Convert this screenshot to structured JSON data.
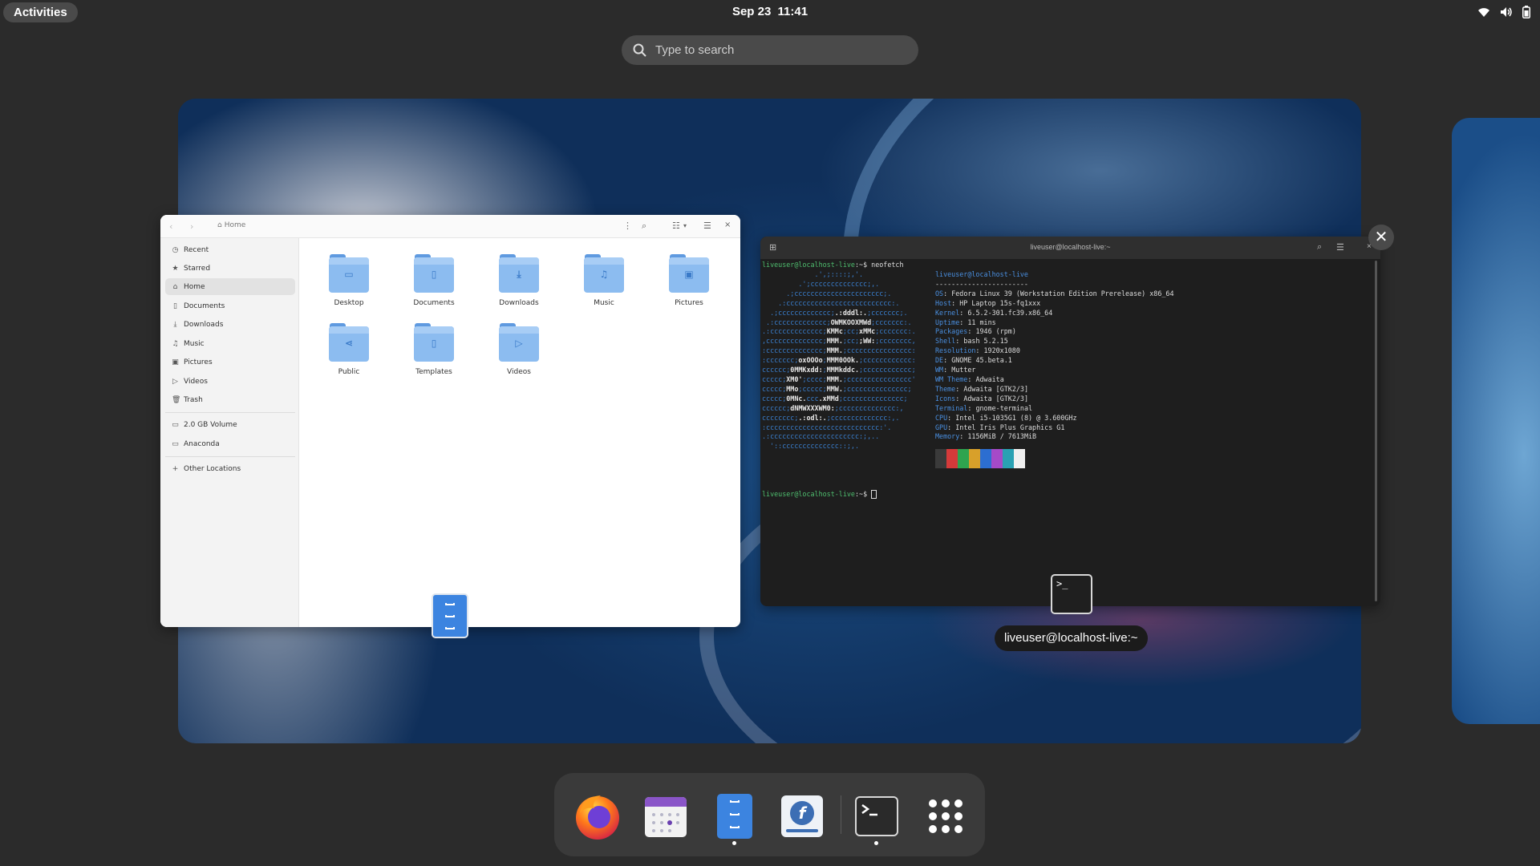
{
  "topbar": {
    "activities_label": "Activities",
    "date": "Sep 23",
    "time": "11:41"
  },
  "search": {
    "placeholder": "Type to search"
  },
  "files_window": {
    "path_label": "Home",
    "sidebar": {
      "places": [
        "Recent",
        "Starred",
        "Home",
        "Documents",
        "Downloads",
        "Music",
        "Pictures",
        "Videos",
        "Trash"
      ],
      "devices": [
        "2.0 GB Volume",
        "Anaconda"
      ],
      "other": "Other Locations",
      "active": "Home"
    },
    "folders": [
      {
        "name": "Desktop",
        "icon": "desktop-icon"
      },
      {
        "name": "Documents",
        "icon": "document-icon"
      },
      {
        "name": "Downloads",
        "icon": "download-icon"
      },
      {
        "name": "Music",
        "icon": "music-icon"
      },
      {
        "name": "Pictures",
        "icon": "picture-icon"
      },
      {
        "name": "Public",
        "icon": "share-icon"
      },
      {
        "name": "Templates",
        "icon": "template-icon"
      },
      {
        "name": "Videos",
        "icon": "video-icon"
      }
    ]
  },
  "terminal_window": {
    "title": "liveuser@localhost-live:~",
    "prompt": "liveuser@localhost-live",
    "prompt_suffix": ":~$ ",
    "command": "neofetch",
    "user_host": "liveuser@localhost-live",
    "separator": "-----------------------",
    "info": [
      {
        "key": "OS",
        "value": "Fedora Linux 39 (Workstation Edition Prerelease) x86_64"
      },
      {
        "key": "Host",
        "value": "HP Laptop 15s-fq1xxx"
      },
      {
        "key": "Kernel",
        "value": "6.5.2-301.fc39.x86_64"
      },
      {
        "key": "Uptime",
        "value": "11 mins"
      },
      {
        "key": "Packages",
        "value": "1946 (rpm)"
      },
      {
        "key": "Shell",
        "value": "bash 5.2.15"
      },
      {
        "key": "Resolution",
        "value": "1920x1080"
      },
      {
        "key": "DE",
        "value": "GNOME 45.beta.1"
      },
      {
        "key": "WM",
        "value": "Mutter"
      },
      {
        "key": "WM Theme",
        "value": "Adwaita"
      },
      {
        "key": "Theme",
        "value": "Adwaita [GTK2/3]"
      },
      {
        "key": "Icons",
        "value": "Adwaita [GTK2/3]"
      },
      {
        "key": "Terminal",
        "value": "gnome-terminal"
      },
      {
        "key": "CPU",
        "value": "Intel i5-1035G1 (8) @ 3.600GHz"
      },
      {
        "key": "GPU",
        "value": "Intel Iris Plus Graphics G1"
      },
      {
        "key": "Memory",
        "value": "1156MiB / 7613MiB"
      }
    ],
    "swatch_colors": [
      "#3a3a3a",
      "#d53a3a",
      "#2ea44f",
      "#d8a02a",
      "#2c6ed1",
      "#a54ac8",
      "#2aa1b3",
      "#f0f0f0"
    ],
    "tooltip": "liveuser@localhost-live:~",
    "badge_glyph": ">_"
  },
  "dock": {
    "items": [
      {
        "name": "Firefox",
        "icon": "firefox-icon",
        "running": false
      },
      {
        "name": "Calendar",
        "icon": "calendar-icon",
        "running": false
      },
      {
        "name": "Files",
        "icon": "files-icon",
        "running": true
      },
      {
        "name": "Fedora Media Writer",
        "icon": "fedora-icon",
        "running": false
      },
      {
        "name": "Terminal",
        "icon": "terminal-icon",
        "running": true
      },
      {
        "name": "Show Apps",
        "icon": "app-grid-icon",
        "running": false
      }
    ]
  }
}
